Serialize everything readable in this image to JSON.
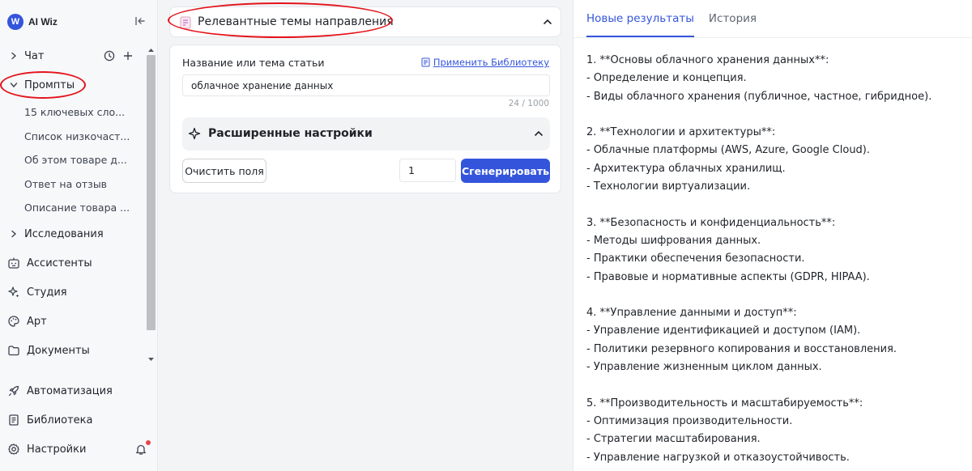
{
  "app": {
    "logo_letter": "W",
    "name": "AI Wiz"
  },
  "sidebar": {
    "chat": {
      "label": "Чат"
    },
    "prompts": {
      "label": "Промпты",
      "items": [
        "15 ключевых сло...",
        "Список низкочаст...",
        "Об этом товаре д...",
        "Ответ на отзыв",
        "Описание товара ..."
      ]
    },
    "research": {
      "label": "Исследования"
    },
    "assistants": {
      "label": "Ассистенты"
    },
    "studio": {
      "label": "Студия"
    },
    "art": {
      "label": "Арт"
    },
    "documents": {
      "label": "Документы"
    },
    "automation": {
      "label": "Автоматизация"
    },
    "library": {
      "label": "Библиотека"
    },
    "settings": {
      "label": "Настройки"
    }
  },
  "middle": {
    "section_title": "Релевантные темы направления",
    "form": {
      "field_label": "Название или тема статьи",
      "apply_library": "Применить Библиотеку",
      "topic_value": "облачное хранение данных",
      "char_count": "24 / 1000",
      "advanced_title": "Расширенные настройки",
      "clear_label": "Очистить поля",
      "quantity": "1",
      "generate_label": "Сгенерировать"
    }
  },
  "right": {
    "tabs": [
      "Новые результаты",
      "История"
    ],
    "result_lines": [
      "1. **Основы облачного хранения данных**:",
      "- Определение и концепция.",
      "- Виды облачного хранения (публичное, частное, гибридное).",
      "",
      "2. **Технологии и архитектуры**:",
      "- Облачные платформы (AWS, Azure, Google Cloud).",
      "- Архитектура облачных хранилищ.",
      "- Технологии виртуализации.",
      "",
      "3. **Безопасность и конфиденциальность**:",
      "- Методы шифрования данных.",
      "- Практики обеспечения безопасности.",
      "- Правовые и нормативные аспекты (GDPR, HIPAA).",
      "",
      "4. **Управление данными и доступ**:",
      "- Управление идентификацией и доступом (IAM).",
      "- Политики резервного копирования и восстановления.",
      "- Управление жизненным циклом данных.",
      "",
      "5. **Производительность и масштабируемость**:",
      "- Оптимизация производительности.",
      "- Стратегии масштабирования.",
      "- Управление нагрузкой и отказоустойчивость."
    ]
  },
  "colors": {
    "accent": "#3455db",
    "annotation_red": "#e3141b",
    "notification": "#e5484d"
  }
}
